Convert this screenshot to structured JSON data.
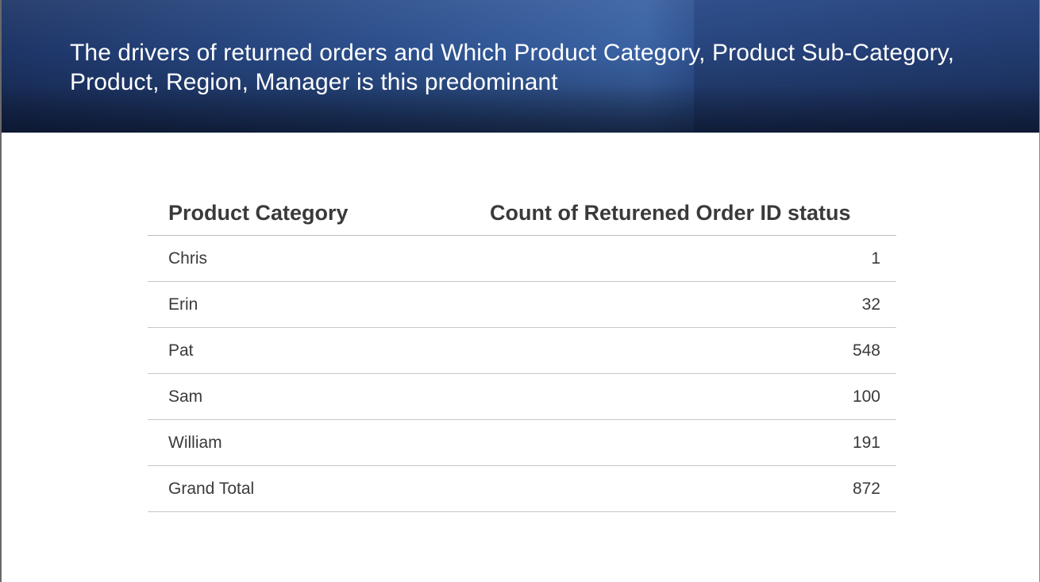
{
  "slide": {
    "title": "The drivers of returned orders and Which Product Category, Product Sub-Category, Product, Region, Manager is this predominant"
  },
  "table": {
    "headers": [
      "Product Category",
      "Count of Returened Order ID status"
    ],
    "rows": [
      {
        "name": "Chris",
        "count": "1"
      },
      {
        "name": "Erin",
        "count": "32"
      },
      {
        "name": "Pat",
        "count": "548"
      },
      {
        "name": "Sam",
        "count": "100"
      },
      {
        "name": "William",
        "count": "191"
      }
    ],
    "total": {
      "name": "Grand Total",
      "count": "872"
    }
  },
  "colors": {
    "banner_dark": "#1d3466",
    "banner_light": "#3a62a3",
    "text": "#3a3a3a"
  }
}
